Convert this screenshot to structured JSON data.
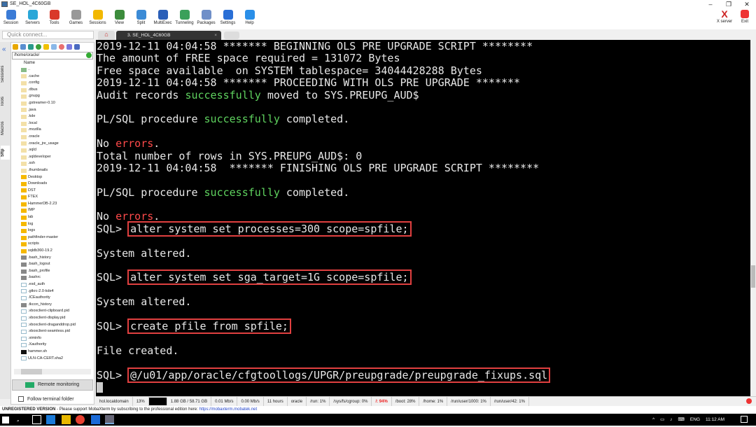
{
  "window": {
    "title": "SE_HOL_4C60GB",
    "minimize": "–",
    "restore": "❐",
    "close": "✕"
  },
  "toolbar": {
    "items": [
      {
        "label": "Session",
        "color": "#3b7bd6"
      },
      {
        "label": "Servers",
        "color": "#2aa7d8"
      },
      {
        "label": "Tools",
        "color": "#d9392a"
      },
      {
        "label": "Games",
        "color": "#999999"
      },
      {
        "label": "Sessions",
        "color": "#f2b800"
      },
      {
        "label": "View",
        "color": "#3c8c3c"
      },
      {
        "label": "Split",
        "color": "#3b8bd6"
      },
      {
        "label": "MultiExec",
        "color": "#2a5fb8"
      },
      {
        "label": "Tunneling",
        "color": "#3aa05a"
      },
      {
        "label": "Packages",
        "color": "#6f8fc8"
      },
      {
        "label": "Settings",
        "color": "#2a6fd6"
      },
      {
        "label": "Help",
        "color": "#2a8fe8"
      }
    ],
    "xserver": "X server",
    "exit": "Exit"
  },
  "quick_connect": {
    "placeholder": "Quick connect..."
  },
  "tabs": {
    "active": "3. SE_HOL_4C60GB",
    "close": "×"
  },
  "side_tabs": [
    "Sessions",
    "Tools",
    "Macros",
    "Sftp"
  ],
  "sftp": {
    "path": "/home/oracle/",
    "column": "Name",
    "files": [
      {
        "name": "..",
        "type": "up"
      },
      {
        "name": ".cache",
        "type": "dot"
      },
      {
        "name": ".config",
        "type": "dot"
      },
      {
        "name": ".dbus",
        "type": "dot"
      },
      {
        "name": ".gnupg",
        "type": "dot"
      },
      {
        "name": ".gstreamer-0.10",
        "type": "dot"
      },
      {
        "name": ".java",
        "type": "dot"
      },
      {
        "name": ".kde",
        "type": "dot"
      },
      {
        "name": ".local",
        "type": "dot"
      },
      {
        "name": ".mozilla",
        "type": "dot"
      },
      {
        "name": ".oracle",
        "type": "dot"
      },
      {
        "name": ".oracle_jre_usage",
        "type": "dot"
      },
      {
        "name": ".sqlcl",
        "type": "dot"
      },
      {
        "name": ".sqldeveloper",
        "type": "dot"
      },
      {
        "name": ".ssh",
        "type": "dot"
      },
      {
        "name": ".thumbnails",
        "type": "dot"
      },
      {
        "name": "Desktop",
        "type": "dir"
      },
      {
        "name": "Downloads",
        "type": "dir"
      },
      {
        "name": "DST",
        "type": "dir"
      },
      {
        "name": "FTEX",
        "type": "dir"
      },
      {
        "name": "HammerDB-2.23",
        "type": "dir"
      },
      {
        "name": "IMP",
        "type": "dir"
      },
      {
        "name": "lab",
        "type": "dir"
      },
      {
        "name": "log",
        "type": "dir"
      },
      {
        "name": "logs",
        "type": "dir"
      },
      {
        "name": "pathfinder-master",
        "type": "dir"
      },
      {
        "name": "scripts",
        "type": "dir"
      },
      {
        "name": "sqldb360-19.2",
        "type": "dir"
      },
      {
        "name": ".bash_history",
        "type": "dark"
      },
      {
        "name": ".bash_logout",
        "type": "dark"
      },
      {
        "name": ".bash_profile",
        "type": "dark"
      },
      {
        "name": ".bashrc",
        "type": "dark"
      },
      {
        "name": ".esd_auth",
        "type": "file"
      },
      {
        "name": ".gtkrc-2.0-kde4",
        "type": "file"
      },
      {
        "name": ".ICEauthority",
        "type": "file"
      },
      {
        "name": ".tkcon_history",
        "type": "dark"
      },
      {
        "name": ".vboxclient-clipboard.pid",
        "type": "file"
      },
      {
        "name": ".vboxclient-display.pid",
        "type": "file"
      },
      {
        "name": ".vboxclient-draganddrop.pid",
        "type": "file"
      },
      {
        "name": ".vboxclient-seamless.pid",
        "type": "file"
      },
      {
        "name": ".viminfo",
        "type": "file"
      },
      {
        "name": ".Xauthority",
        "type": "file"
      },
      {
        "name": "hammer.sh",
        "type": "exe"
      },
      {
        "name": "ULN-CA-CERT.sha2",
        "type": "file"
      }
    ],
    "remote_monitoring": "Remote monitoring",
    "follow_terminal": "Follow terminal folder"
  },
  "terminal": {
    "lines": [
      [
        {
          "t": "2019-12-11 04:04:58 ******* BEGINNING OLS PRE UPGRADE SCRIPT ********"
        }
      ],
      [
        {
          "t": "The amount of FREE space required = 131072 Bytes"
        }
      ],
      [
        {
          "t": "Free space available  on SYSTEM tablespace= 34044428288 Bytes"
        }
      ],
      [
        {
          "t": "2019-12-11 04:04:58 ******* PROCEEDING WITH OLS PRE UPGRADE *******"
        }
      ],
      [
        {
          "t": "Audit records "
        },
        {
          "t": "successfully",
          "c": "g"
        },
        {
          "t": " moved to SYS.PREUPG_AUD$"
        }
      ],
      [],
      [
        {
          "t": "PL/SQL procedure "
        },
        {
          "t": "successfully",
          "c": "g"
        },
        {
          "t": " completed."
        }
      ],
      [],
      [
        {
          "t": "No "
        },
        {
          "t": "errors",
          "c": "r"
        },
        {
          "t": "."
        }
      ],
      [
        {
          "t": "Total number of rows in SYS.PREUPG_AUD$: 0"
        }
      ],
      [
        {
          "t": "2019-12-11 04:04:58  ******* FINISHING OLS PRE UPGRADE SCRIPT ********"
        }
      ],
      [],
      [
        {
          "t": "PL/SQL procedure "
        },
        {
          "t": "successfully",
          "c": "g"
        },
        {
          "t": " completed."
        }
      ],
      [],
      [
        {
          "t": "No "
        },
        {
          "t": "errors",
          "c": "r"
        },
        {
          "t": "."
        }
      ],
      [
        {
          "t": "SQL> "
        },
        {
          "t": "alter system set processes=300 scope=spfile;",
          "c": "box"
        }
      ],
      [],
      [
        {
          "t": "System altered."
        }
      ],
      [],
      [
        {
          "t": "SQL> "
        },
        {
          "t": "alter system set sga_target=1G scope=spfile;",
          "c": "box"
        }
      ],
      [],
      [
        {
          "t": "System altered."
        }
      ],
      [],
      [
        {
          "t": "SQL> "
        },
        {
          "t": "create pfile from spfile;",
          "c": "box"
        }
      ],
      [],
      [
        {
          "t": "File created."
        }
      ],
      [],
      [
        {
          "t": "SQL> "
        },
        {
          "t": "@/u01/app/oracle/cfgtoollogs/UPGR/preupgrade/preupgrade_fixups.sql",
          "c": "box"
        }
      ],
      [
        {
          "t": "",
          "c": "cursor"
        }
      ]
    ]
  },
  "status": {
    "host": "hol.localdomain",
    "cpu": "13%",
    "mem": "1.88 GB / 58.71 GB",
    "up": "0.01 Mb/s",
    "down": "0.00 Mb/s",
    "uptime": "11 hours",
    "user": "oracle",
    "disks": [
      {
        "t": "/run: 1%"
      },
      {
        "t": "/sys/fs/cgroup: 0%"
      },
      {
        "t": "/: 94%",
        "warn": true
      },
      {
        "t": "/boot: 28%"
      },
      {
        "t": "/home: 1%"
      },
      {
        "t": "/run/user/1000: 1%"
      },
      {
        "t": "/run/user/42: 1%"
      }
    ]
  },
  "banner": {
    "bold": "UNREGISTERED VERSION",
    "text": "  -  Please support MobaXterm by subscribing to the professional edition here:  ",
    "link": "https://mobaxterm.mobatek.net"
  },
  "taskbar": {
    "lang": "ENG",
    "time": "11:12 AM"
  }
}
